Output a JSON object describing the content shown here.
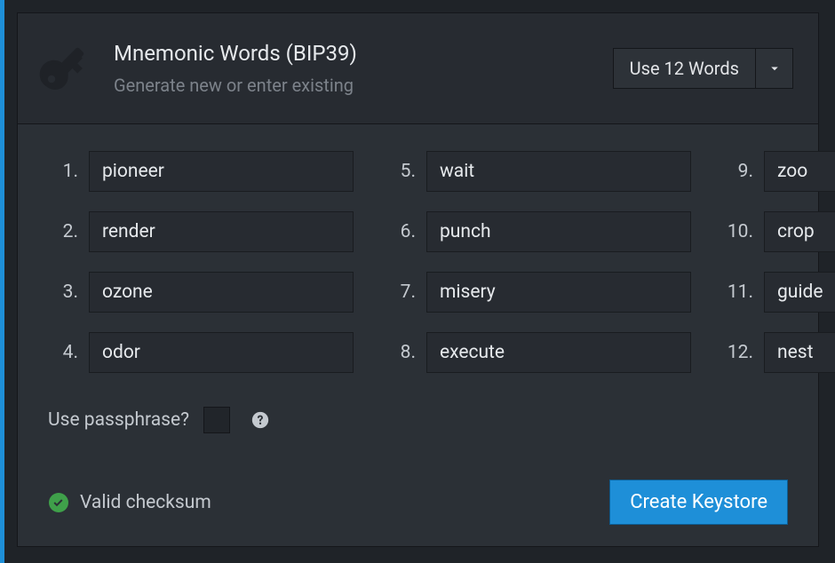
{
  "header": {
    "title": "Mnemonic Words (BIP39)",
    "subtitle": "Generate new or enter existing"
  },
  "word_count": {
    "selected": "Use 12 Words"
  },
  "words": [
    {
      "num": "1.",
      "value": "pioneer"
    },
    {
      "num": "2.",
      "value": "render"
    },
    {
      "num": "3.",
      "value": "ozone"
    },
    {
      "num": "4.",
      "value": "odor"
    },
    {
      "num": "5.",
      "value": "wait"
    },
    {
      "num": "6.",
      "value": "punch"
    },
    {
      "num": "7.",
      "value": "misery"
    },
    {
      "num": "8.",
      "value": "execute"
    },
    {
      "num": "9.",
      "value": "zoo"
    },
    {
      "num": "10.",
      "value": "crop"
    },
    {
      "num": "11.",
      "value": "guide"
    },
    {
      "num": "12.",
      "value": "nest"
    }
  ],
  "passphrase": {
    "label": "Use passphrase?",
    "checked": false
  },
  "status": {
    "text": "Valid checksum"
  },
  "actions": {
    "create": "Create Keystore"
  },
  "colors": {
    "accent": "#1e8fd8",
    "success": "#3fa04a"
  }
}
